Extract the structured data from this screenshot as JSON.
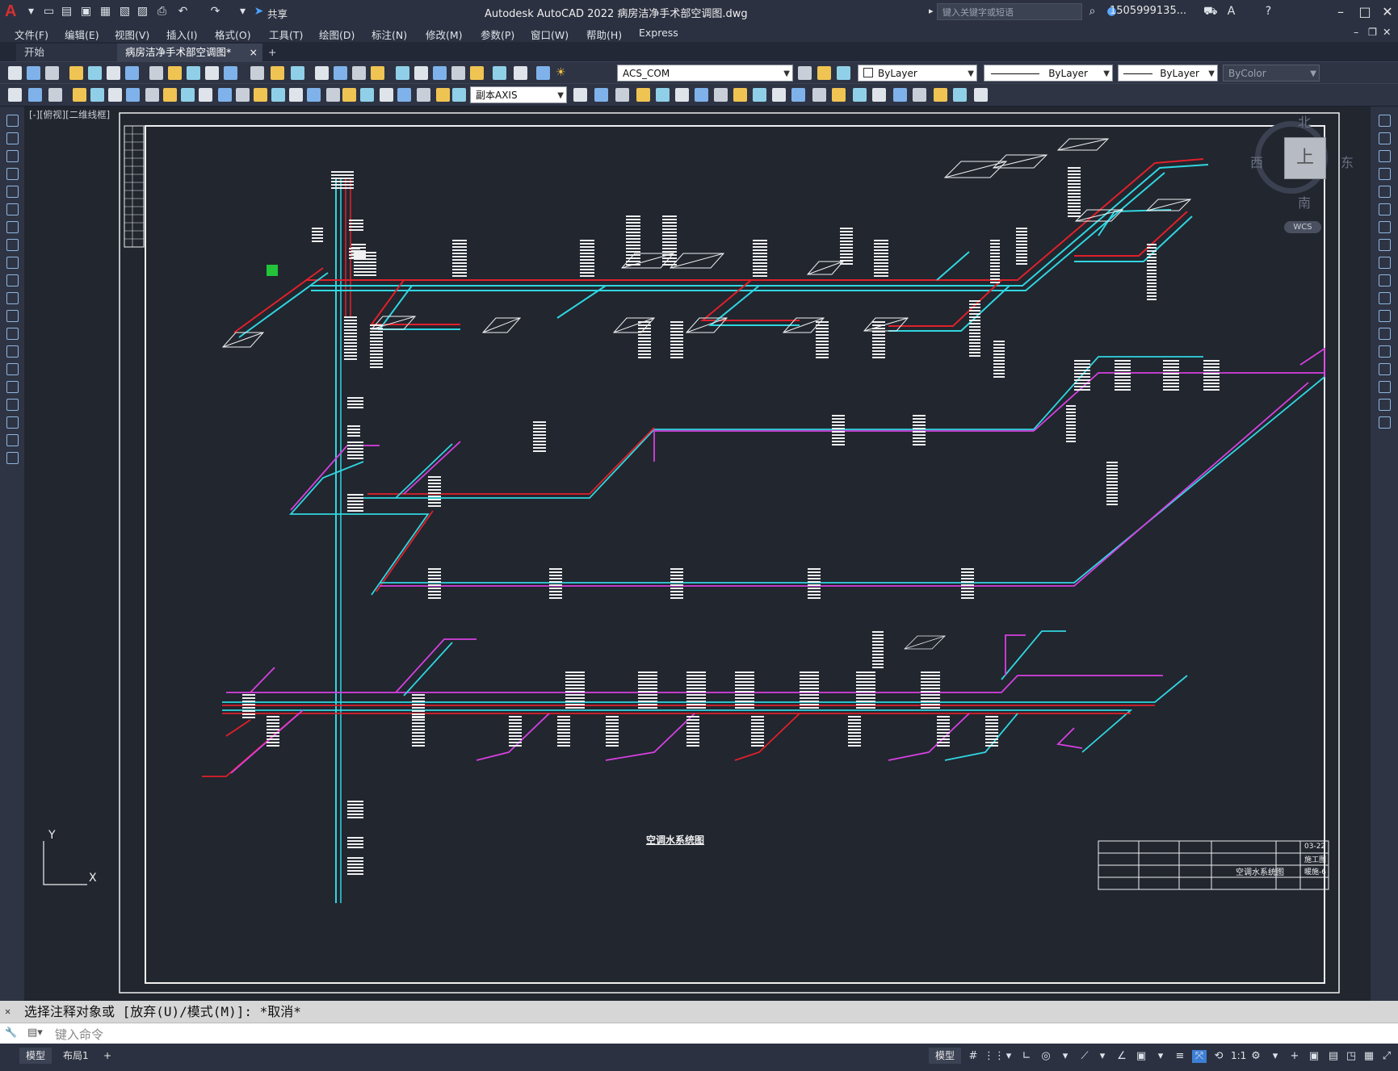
{
  "app": {
    "title": "Autodesk AutoCAD 2022    病房洁净手术部空调图.dwg",
    "share_label": "共享",
    "search_placeholder": "键入关键字或短语",
    "user": "1505999135...",
    "logo": "A"
  },
  "menus": [
    "文件(F)",
    "编辑(E)",
    "视图(V)",
    "插入(I)",
    "格式(O)",
    "工具(T)",
    "绘图(D)",
    "标注(N)",
    "修改(M)",
    "参数(P)",
    "窗口(W)",
    "帮助(H)",
    "Express"
  ],
  "tabs": {
    "home": "开始",
    "doc": "病房洁净手术部空调图*",
    "close": "×",
    "add": "+"
  },
  "toolbar": {
    "textstyle": "ACS_COM",
    "layer_color": "ByLayer",
    "linetype": "ByLayer",
    "lineweight": "ByLayer",
    "plotstyle": "ByColor",
    "dimstyle": "副本AXIS"
  },
  "viewport": {
    "label": "[-][俯视][二维线框]",
    "drawing_title": "空调水系统图",
    "viewcube": {
      "top": "上",
      "north": "北",
      "south": "南",
      "east": "东",
      "west": "西",
      "wcs": "WCS"
    },
    "ucs": {
      "x": "X",
      "y": "Y"
    },
    "titleblock": {
      "sheet_no": "暖施-6",
      "rev": "03-22",
      "name": "空调水系统图",
      "stage": "施工图"
    }
  },
  "command": {
    "history": "选择注释对象或 [放弃(U)/模式(M)]: *取消*",
    "placeholder": "键入命令"
  },
  "status": {
    "model_tab": "模型",
    "layout_tab": "布局1",
    "add": "+",
    "model_btn": "模型",
    "scale": "1:1"
  },
  "colors": {
    "red": "#e0202a",
    "cyan": "#30d6e0",
    "magenta": "#d640e0",
    "white": "#f0f0f0",
    "bg": "#21262f"
  }
}
